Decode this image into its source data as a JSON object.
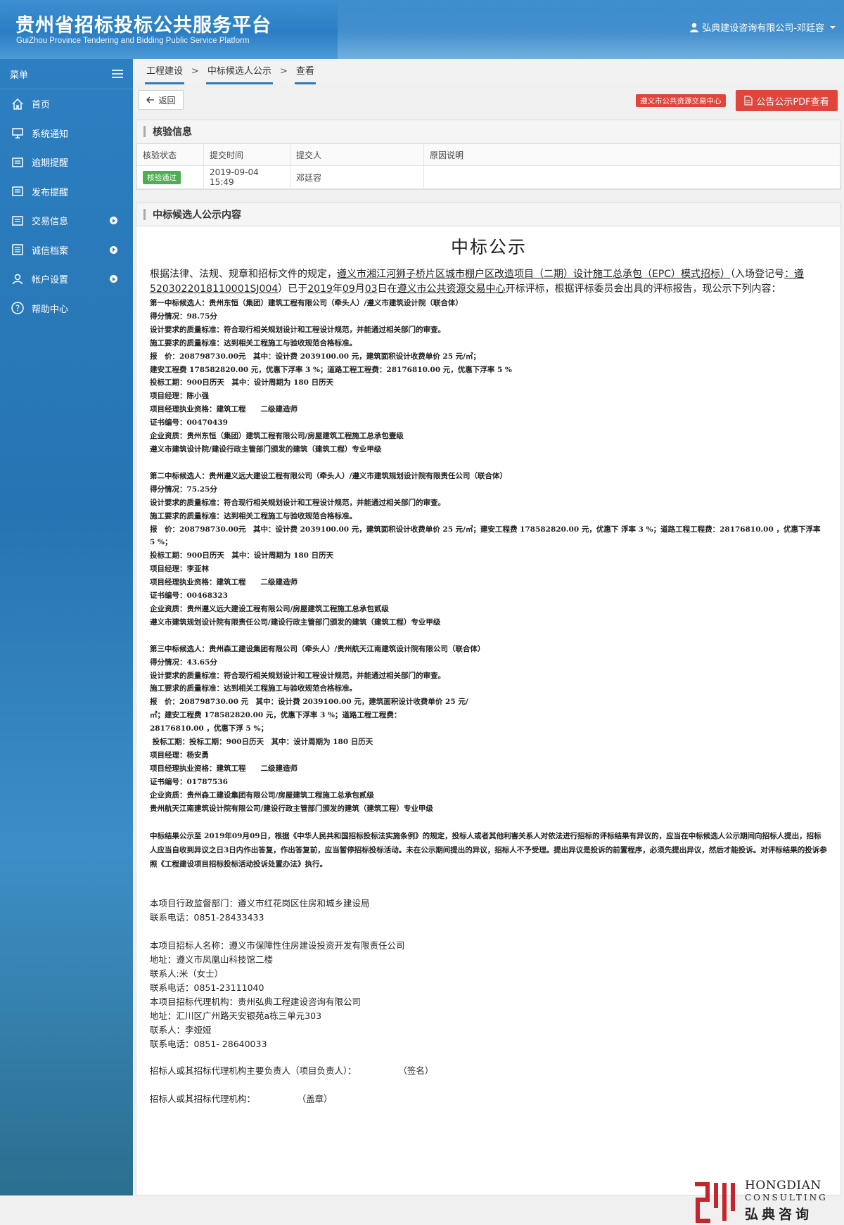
{
  "header": {
    "title": "贵州省招标投标公共服务平台",
    "subtitle": "GuiZhou Province Tendering and Bidding Public Service Platform",
    "user": "弘典建设咨询有限公司-邓廷容"
  },
  "sidebar": {
    "menu_label": "菜单",
    "items": [
      {
        "label": "首页",
        "icon": "home-icon"
      },
      {
        "label": "系统通知",
        "icon": "monitor-icon"
      },
      {
        "label": "逾期提醒",
        "icon": "card-icon"
      },
      {
        "label": "发布提醒",
        "icon": "card-icon"
      },
      {
        "label": "交易信息",
        "icon": "card-icon",
        "expandable": true
      },
      {
        "label": "诚信档案",
        "icon": "list-icon",
        "expandable": true
      },
      {
        "label": "帐户设置",
        "icon": "user-icon",
        "expandable": true
      },
      {
        "label": "帮助中心",
        "icon": "help-icon"
      }
    ]
  },
  "breadcrumb": [
    "工程建设",
    "中标候选人公示",
    "查看"
  ],
  "toolbar": {
    "back": "返回",
    "link_tag": "遵义市公共资源交易中心",
    "pdf_button": "公告公示PDF查看"
  },
  "verify": {
    "title": "核验信息",
    "columns": [
      "核验状态",
      "提交时间",
      "提交人",
      "原因说明"
    ],
    "row": {
      "status": "核验通过",
      "time": "2019-09-04 15:49",
      "submitter": "邓廷容",
      "reason": ""
    }
  },
  "content": {
    "panel_title": "中标候选人公示内容",
    "doc_title": "中标公示",
    "intro": {
      "p1": "根据法律、法规、规章和招标文件的规定，",
      "project": "遵义市湘江河狮子桥片区城市棚户区改造项目（二期）设计施工总承包（EPC）模式招标）",
      "p2": "（入场登记号",
      "reg_no": "：遵5203022018110001SJ004",
      "p3": "）已于",
      "year": "2019",
      "p4": "年",
      "month": "09",
      "p5": "月",
      "day": "03",
      "p6": "日在",
      "venue": "遵义市公共资源交易中心",
      "p7": "开标评标，根据评标委员会出具的评标报告，现公示下列内容："
    },
    "candidates": [
      [
        "第一中标候选人：贵州东恒（集团）建筑工程有限公司（牵头人）/遵义市建筑设计院（联合体）",
        "得分情况：98.75分",
        "设计要求的质量标准：符合现行相关规划设计和工程设计规范，并能通过相关部门的审查。",
        "施工要求的质量标准：达到相关工程施工与验收规范合格标准。",
        "报　价：208798730.00元　其中：设计费 2039100.00 元，建筑面积设计收费单价 25 元/㎡；",
        "建安工程费 178582820.00 元，优惠下浮率 3 %；道路工程工程费：28176810.00 元，优惠下浮率 5 %",
        "投标工期：900日历天　其中：设计周期为 180 日历天",
        "项目经理：陈小强",
        "项目经理执业资格：建筑工程　　二级建造师",
        "证书编号：00470439",
        "企业资质：贵州东恒（集团）建筑工程有限公司/房屋建筑工程施工总承包壹级",
        "遵义市建筑设计院/建设行政主管部门颁发的建筑（建筑工程）专业甲级"
      ],
      [
        "第二中标候选人：贵州遵义远大建设工程有限公司（牵头人）/遵义市建筑规划设计院有限责任公司（联合体）",
        "得分情况：75.25分",
        "设计要求的质量标准：符合现行相关规划设计和工程设计规范，并能通过相关部门的审查。",
        "施工要求的质量标准：达到相关工程施工与验收规范合格标准。",
        "报　价：208798730.00元　其中：设计费 2039100.00 元，建筑面积设计收费单价 25 元/㎡；建安工程费 178582820.00 元，优惠下 浮率 3 %；道路工程工程费：28176810.00 ，优惠下浮率 5 %；",
        "投标工期：900日历天　其中：设计周期为 180 日历天",
        "项目经理：李亚林",
        "项目经理执业资格：建筑工程　　二级建造师",
        "证书编号：00468323",
        "企业资质：贵州遵义远大建设工程有限公司/房屋建筑工程施工总承包贰级",
        "遵义市建筑规划设计院有限责任公司/建设行政主管部门颁发的建筑（建筑工程）专业甲级"
      ],
      [
        "第三中标候选人：贵州森工建设集团有限公司（牵头人）/贵州航天江南建筑设计院有限公司（联合体）",
        "得分情况：43.65分",
        "设计要求的质量标准：符合现行相关规划设计和工程设计规范，并能通过相关部门的审查。",
        "施工要求的质量标准：达到相关工程施工与验收规范合格标准。",
        "报　价：208798730.00 元　其中：设计费 2039100.00 元，建筑面积设计收费单价 25 元/",
        "㎡；建安工程费 178582820.00 元，优惠下浮率 3 %；道路工程工程费：",
        "28176810.00 ，优惠下浮 5 %；",
        " 投标工期：投标工期：900日历天　其中：设计周期为 180 日历天",
        "项目经理：杨安勇",
        "项目经理执业资格：建筑工程　　二级建造师",
        "证书编号：01787536",
        "企业资质：贵州森工建设集团有限公司/房屋建筑工程施工总承包贰级",
        "贵州航天江南建筑设计院有限公司/建设行政主管部门颁发的建筑（建筑工程）专业甲级"
      ]
    ],
    "notice": "中标结果公示至 2019年09月09日，根据《中华人民共和国招标投标法实施条例》的规定，投标人或者其他利害关系人对依法进行招标的评标结果有异议的，应当在中标候选人公示期间向招标人提出，招标人应当自收到异议之日3日内作出答复，作出答复前，应当暂停招标投标活动。未在公示期间提出的异议，招标人不予受理。提出异议是投诉的前置程序，必须先提出异议，然后才能投诉。对评标结果的投诉参照《工程建设项目招标投标活动投诉处置办法》执行。",
    "supervisor": [
      "本项目行政监督部门：遵义市红花岗区住房和城乡建设局",
      "联系电话：0851-28433433"
    ],
    "contacts": [
      "本项目招标人名称：遵义市保障性住房建设投资开发有限责任公司",
      "地址：遵义市凤凰山科技馆二楼",
      "联系人:米（女士）",
      "联系电话：0851-23111040",
      "本项目招标代理机构：贵州弘典工程建设咨询有限公司",
      "地址：汇川区广州路天安银苑a栋三单元303",
      "联系人：李娅娅",
      "联系电话：0851- 28640033"
    ],
    "sign_principal": "招标人或其招标代理机构主要负责人（项目负责人）：               （签名）",
    "sign_seal": "招标人或其招标代理机构：               （盖章）",
    "logo": {
      "en1": "HONGDIAN",
      "en2": "CONSULTING",
      "cn": "弘典咨询",
      "color": "#c1272d"
    }
  }
}
